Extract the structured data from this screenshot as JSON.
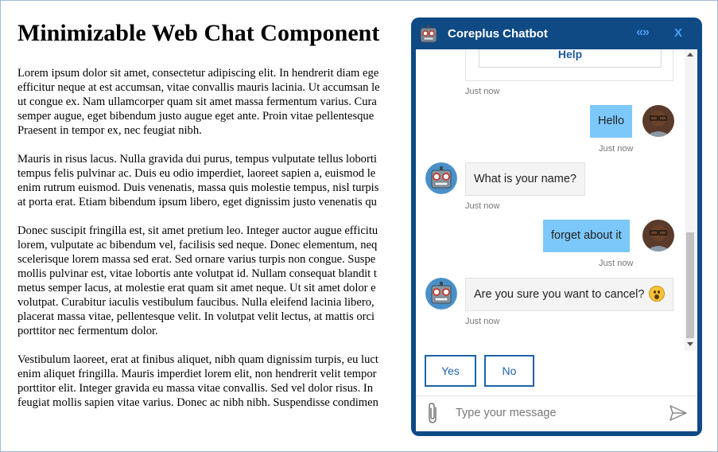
{
  "page": {
    "title": "Minimizable Web Chat Component",
    "paragraphs": [
      [
        "Lorem ipsum dolor sit amet, consectetur adipiscing elit. In hendrerit diam ege",
        "efficitur neque at est accumsan, vitae convallis mauris lacinia. Ut accumsan le",
        "ut congue ex. Nam ullamcorper quam sit amet massa fermentum varius. Cura",
        "semper augue, eget bibendum justo augue eget ante. Proin vitae pellentesque",
        "Praesent in tempor ex, nec feugiat nibh."
      ],
      [
        "Mauris in risus lacus. Nulla gravida dui purus, tempus vulputate tellus loborti",
        "tempus felis pulvinar ac. Duis eu odio imperdiet, laoreet sapien a, euismod le",
        "enim rutrum euismod. Duis venenatis, massa quis molestie tempus, nisl turpis",
        "at porta erat. Etiam bibendum ipsum libero, eget dignissim justo venenatis qu"
      ],
      [
        "Donec suscipit fringilla est, sit amet pretium leo. Integer auctor augue efficitu",
        "lorem, vulputate ac bibendum vel, facilisis sed neque. Donec elementum, neq",
        "scelerisque lorem massa sed erat. Sed ornare varius turpis non congue. Suspe",
        "mollis pulvinar est, vitae lobortis ante volutpat id. Nullam consequat blandit t",
        "metus semper lacus, at molestie erat quam sit amet neque. Ut sit amet dolor e",
        "volutpat. Curabitur iaculis vestibulum faucibus. Nulla eleifend lacinia libero,",
        "placerat massa vitae, pellentesque velit. In volutpat velit lectus, at mattis orci",
        "porttitor nec fermentum dolor."
      ],
      [
        "Vestibulum laoreet, erat at finibus aliquet, nibh quam dignissim turpis, eu luct",
        "enim aliquet fringilla. Mauris imperdiet lorem elit, non hendrerit velit tempor",
        "porttitor elit. Integer gravida eu massa vitae convallis. Sed vel dolor risus. In",
        "feugiat mollis sapien vitae varius. Donec ac nibh nibh. Suspendisse condimen"
      ]
    ]
  },
  "chat": {
    "title": "Coreplus Chatbot",
    "minimize_label": "«»",
    "close_label": "X",
    "card_button": "Help",
    "messages": [
      {
        "from": "user",
        "text": "Hello",
        "time": "Just now"
      },
      {
        "from": "bot",
        "text": "What is your name?",
        "time": "Just now"
      },
      {
        "from": "user",
        "text": "forget about it",
        "time": "Just now"
      },
      {
        "from": "bot",
        "text": "Are you sure you want to cancel?",
        "time": "Just now"
      }
    ],
    "card_time": "Just now",
    "suggested_actions": [
      "Yes",
      "No"
    ],
    "input_placeholder": "Type your message",
    "icons": {
      "attach": "paperclip-icon",
      "send": "send-icon",
      "bot": "robot-icon"
    },
    "colors": {
      "header": "#0f4a84",
      "user_bubble": "#7dc8fa",
      "button": "#1d62a8"
    }
  }
}
